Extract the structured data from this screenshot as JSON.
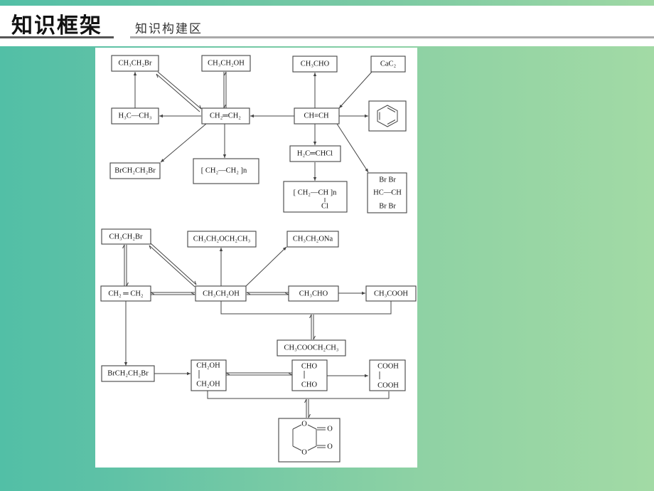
{
  "header": {
    "title": "知识框架",
    "subtitle": "知识构建区"
  },
  "colors": {
    "accent_teal": "#53bfa6",
    "accent_green": "#a2daa5",
    "line": "#444444"
  },
  "diagram1": {
    "name": "acetylene-ethylene-network",
    "nodes": {
      "ch3ch2br": "CH₃CH₂Br",
      "ch3ch2oh": "CH₃CH₂OH",
      "ch3cho": "CH₃CHO",
      "cac2": "CaC₂",
      "ethane": "H₃C—CH₃",
      "ethylene": "CH₂═CH₂",
      "acetylene": "CH≡CH",
      "benzene": "benzene",
      "dibromoethane": "BrCH₂CH₂Br",
      "polyethylene": "[ CH₂—CH₂ ]n",
      "vinyl_chloride": "H₂C═CHCl",
      "pvc_main": "[ CH₂—CH ]n",
      "pvc_sub": "Cl",
      "tetrabromo_top": "Br   Br",
      "tetrabromo_mid": "HC—CH",
      "tetrabromo_bot": "Br   Br"
    }
  },
  "diagram2": {
    "name": "ethanol-network",
    "nodes": {
      "ch3ch2br": "CH₃CH₂Br",
      "ether": "CH₃CH₂OCH₂CH₃",
      "sodium_ethoxide": "CH₃CH₂ONa",
      "ethylene": "CH₂ ═ CH₂",
      "ethanol": "CH₃CH₂OH",
      "acetaldehyde": "CH₃CHO",
      "acetic_acid": "CH₃COOH",
      "ethyl_acetate": "CH₃COOCH₂CH₃",
      "dibromoethane": "BrCH₂CH₂Br",
      "glycol_top": "CH₂OH",
      "glycol_bot": "CH₂OH",
      "glyoxal_top": "CHO",
      "glyoxal_bot": "CHO",
      "oxalic_top": "COOH",
      "oxalic_bot": "COOH",
      "ring_o": "O",
      "ring_co": "O"
    }
  }
}
